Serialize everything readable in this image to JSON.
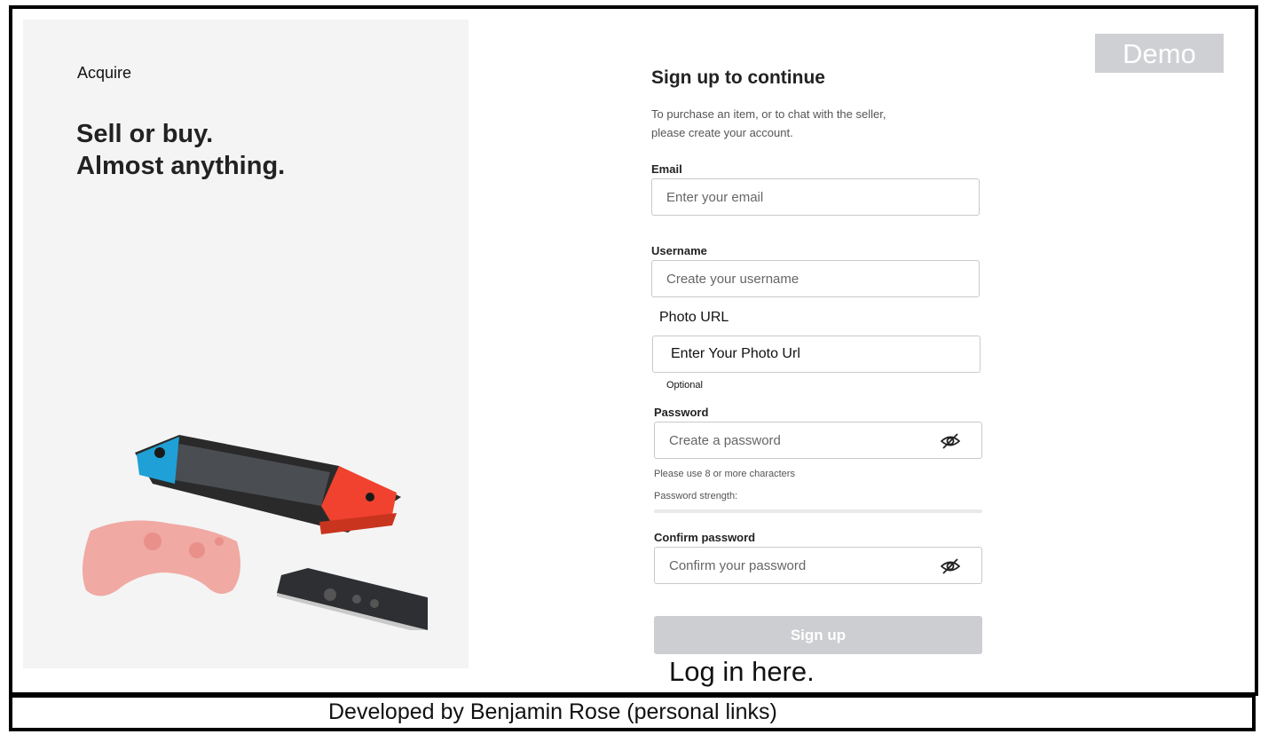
{
  "hero": {
    "brand": "Acquire",
    "tagline_line1": "Sell or buy.",
    "tagline_line2": "Almost anything."
  },
  "badge": {
    "label": "Demo"
  },
  "form": {
    "title": "Sign up to continue",
    "subtitle_line1": "To purchase an item, or to chat with the seller,",
    "subtitle_line2": "please create your account.",
    "email": {
      "label": "Email",
      "placeholder": "Enter your email"
    },
    "username": {
      "label": "Username",
      "placeholder": "Create your username"
    },
    "photo_url": {
      "label": "Photo URL",
      "placeholder": "Enter Your Photo Url",
      "note": "Optional"
    },
    "password": {
      "label": "Password",
      "placeholder": "Create a password",
      "hint": "Please use 8 or more characters",
      "strength_label": "Password strength:"
    },
    "confirm_password": {
      "label": "Confirm password",
      "placeholder": "Confirm your password"
    },
    "submit_label": "Sign up",
    "login_link": "Log in here."
  },
  "footer": {
    "text": "Developed by Benjamin Rose  (personal links)"
  },
  "colors": {
    "hero_bg": "#f4f4f4",
    "disabled_button": "#cdced1",
    "badge_bg": "#cfd0d3"
  }
}
